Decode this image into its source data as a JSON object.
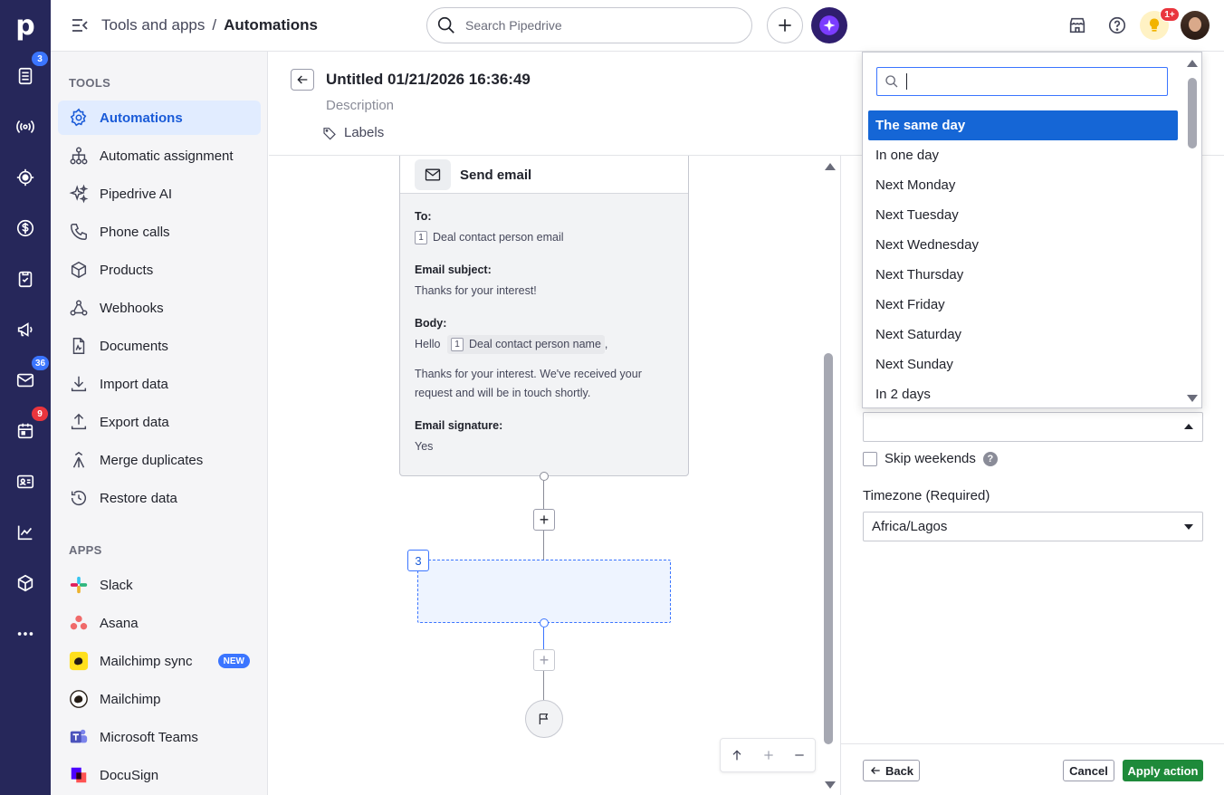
{
  "rail": {
    "logo": "p",
    "badges": {
      "deals": "3",
      "mail": "36",
      "calendar": "9"
    }
  },
  "topbar": {
    "breadcrumb_parent": "Tools and apps",
    "breadcrumb_sep": "/",
    "breadcrumb_current": "Automations",
    "search_placeholder": "Search Pipedrive",
    "notifications_badge": "1+"
  },
  "sidebar": {
    "tools_heading": "TOOLS",
    "tools": [
      {
        "label": "Automations",
        "icon": "automations-icon",
        "active": true
      },
      {
        "label": "Automatic assignment",
        "icon": "assignment-icon"
      },
      {
        "label": "Pipedrive AI",
        "icon": "sparkle-icon"
      },
      {
        "label": "Phone calls",
        "icon": "phone-icon"
      },
      {
        "label": "Products",
        "icon": "box-icon"
      },
      {
        "label": "Webhooks",
        "icon": "webhook-icon"
      },
      {
        "label": "Documents",
        "icon": "document-icon"
      },
      {
        "label": "Import data",
        "icon": "import-icon"
      },
      {
        "label": "Export data",
        "icon": "export-icon"
      },
      {
        "label": "Merge duplicates",
        "icon": "merge-icon"
      },
      {
        "label": "Restore data",
        "icon": "restore-icon"
      }
    ],
    "apps_heading": "APPS",
    "apps": [
      {
        "label": "Slack",
        "icon": "slack-icon"
      },
      {
        "label": "Asana",
        "icon": "asana-icon"
      },
      {
        "label": "Mailchimp sync",
        "icon": "mailchimp-icon",
        "badge": "NEW"
      },
      {
        "label": "Mailchimp",
        "icon": "mailchimp-icon"
      },
      {
        "label": "Microsoft Teams",
        "icon": "teams-icon"
      },
      {
        "label": "DocuSign",
        "icon": "docusign-icon"
      }
    ]
  },
  "editor": {
    "title": "Untitled 01/21/2026 16:36:49",
    "description": "Description",
    "labels": "Labels"
  },
  "card": {
    "title": "Send email",
    "to_label": "To:",
    "to_num": "1",
    "to_value": "Deal contact person email",
    "subject_label": "Email subject:",
    "subject_value": "Thanks for your interest!",
    "body_label": "Body:",
    "body_hello": "Hello",
    "body_token_num": "1",
    "body_token": "Deal contact person name",
    "body_comma": ",",
    "body_text": "Thanks for your interest. We've received your request and will be in touch shortly.",
    "signature_label": "Email signature:",
    "signature_value": "Yes"
  },
  "canvas": {
    "step_number": "3"
  },
  "panel": {
    "skip_weekends": "Skip weekends",
    "help": "?",
    "timezone_label": "Timezone (Required)",
    "timezone_value": "Africa/Lagos",
    "back": "Back",
    "cancel": "Cancel",
    "apply": "Apply action"
  },
  "dropdown": {
    "search_value": "",
    "options": [
      {
        "label": "The same day",
        "selected": true
      },
      {
        "label": "In one day"
      },
      {
        "label": "Next Monday"
      },
      {
        "label": "Next Tuesday"
      },
      {
        "label": "Next Wednesday"
      },
      {
        "label": "Next Thursday"
      },
      {
        "label": "Next Friday"
      },
      {
        "label": "Next Saturday"
      },
      {
        "label": "Next Sunday"
      },
      {
        "label": "In 2 days"
      }
    ]
  },
  "colors": {
    "rail": "#26275a",
    "accent": "#1566d6",
    "apply": "#1e8a3a",
    "badge_red": "#e9353d"
  }
}
